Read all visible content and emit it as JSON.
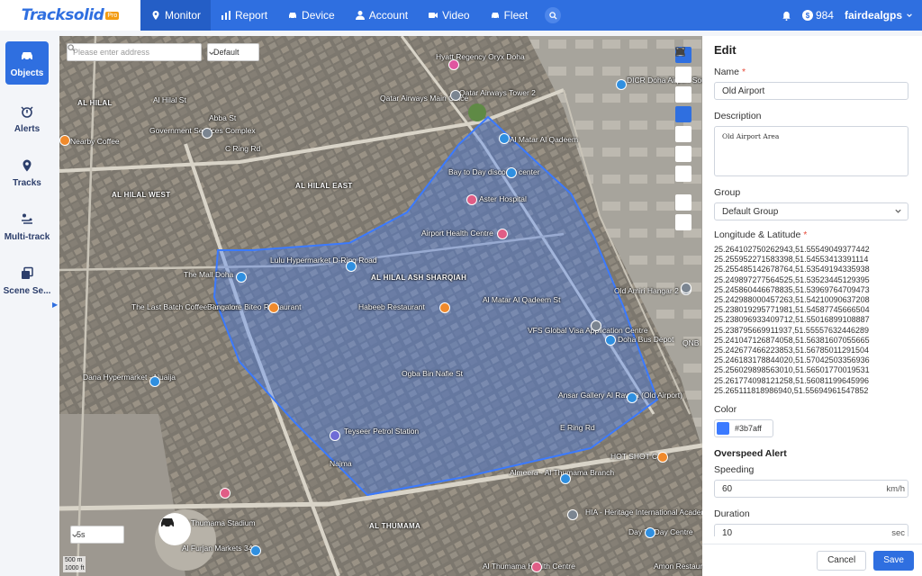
{
  "brand": {
    "name": "Tracksolid",
    "badge": "Pro"
  },
  "nav": [
    {
      "label": "Monitor",
      "icon": "location-pin-icon",
      "active": true
    },
    {
      "label": "Report",
      "icon": "bar-chart-icon"
    },
    {
      "label": "Device",
      "icon": "car-icon"
    },
    {
      "label": "Account",
      "icon": "user-icon"
    },
    {
      "label": "Video",
      "icon": "video-camera-icon"
    },
    {
      "label": "Fleet",
      "icon": "car-icon"
    }
  ],
  "header": {
    "balance": "984",
    "username": "fairdealgps"
  },
  "sidebar": [
    {
      "label": "Objects",
      "icon": "car-icon",
      "active": true
    },
    {
      "label": "Alerts",
      "icon": "alert-icon"
    },
    {
      "label": "Tracks",
      "icon": "location-pin-icon"
    },
    {
      "label": "Multi-track",
      "icon": "multi-track-icon"
    },
    {
      "label": "Scene Se...",
      "icon": "scene-icon"
    }
  ],
  "map": {
    "search_placeholder": "Please enter address",
    "map_type": "Default",
    "interval": "5s",
    "scale_m": "500 m",
    "scale_ft": "1000 ft",
    "geofence_color": "#3b7aff",
    "labels": [
      {
        "text": "Hyatt Regency Oryx Doha",
        "bold": false
      },
      {
        "text": "Qatar Airways Tower 2",
        "bold": false
      },
      {
        "text": "DICR Doha Airport South",
        "bold": false
      },
      {
        "text": "Qatar Airways Main Office",
        "bold": false
      },
      {
        "text": "AL HILAL",
        "bold": true
      },
      {
        "text": "Abba St",
        "bold": false
      },
      {
        "text": "Al Hilal St",
        "bold": false
      },
      {
        "text": "Government Services Complex",
        "bold": false
      },
      {
        "text": "C Ring Rd",
        "bold": false
      },
      {
        "text": "Nearby Coffee",
        "bold": false
      },
      {
        "text": "Al Matar Al Qadeem",
        "bold": false
      },
      {
        "text": "Bay to Day discount center",
        "bold": false
      },
      {
        "text": "AL HILAL WEST",
        "bold": true
      },
      {
        "text": "AL HILAL EAST",
        "bold": true
      },
      {
        "text": "Aster Hospital",
        "bold": false
      },
      {
        "text": "Airport Health Centre",
        "bold": false
      },
      {
        "text": "Lulu Hypermarket D-Ring Road",
        "bold": false
      },
      {
        "text": "The Mall Doha",
        "bold": false
      },
      {
        "text": "AL HILAL ASH SHARQIAH",
        "bold": true
      },
      {
        "text": "Al Matar Al Qadeem St",
        "bold": false
      },
      {
        "text": "The Last Batch Coffee Roasters",
        "bold": false
      },
      {
        "text": "Bangalore Biteo Restaurant",
        "bold": false
      },
      {
        "text": "Habeeb Restaurant",
        "bold": false
      },
      {
        "text": "VFS Global Visa Application Centre",
        "bold": false
      },
      {
        "text": "Old Amiri Hangar 2",
        "bold": false
      },
      {
        "text": "Doha Bus Depot",
        "bold": false
      },
      {
        "text": "QNB",
        "bold": false
      },
      {
        "text": "Dana Hypermarket - Nuaija",
        "bold": false
      },
      {
        "text": "Ogba Bin Nafie St",
        "bold": false
      },
      {
        "text": "Ansar Gallery Al Rawda (Old Airport)",
        "bold": false
      },
      {
        "text": "Teyseer Petrol Station",
        "bold": false
      },
      {
        "text": "E Ring Rd",
        "bold": false
      },
      {
        "text": "HOT SHOT Cafe",
        "bold": false
      },
      {
        "text": "Najma",
        "bold": false
      },
      {
        "text": "Almeera - Al Thumama Branch",
        "bold": false
      },
      {
        "text": "AL THUMAMA",
        "bold": true
      },
      {
        "text": "HIA - Heritage International Academy",
        "bold": false
      },
      {
        "text": "Day To Day Centre",
        "bold": false
      },
      {
        "text": "Al Thumama Stadium",
        "bold": false
      },
      {
        "text": "Al Furjan Markets 34",
        "bold": false
      },
      {
        "text": "Al Thumama Health Centre",
        "bold": false
      },
      {
        "text": "Amon Restaurant",
        "bold": false
      }
    ]
  },
  "panel": {
    "title": "Edit",
    "name_label": "Name",
    "name_value": "Old Airport",
    "description_label": "Description",
    "description_value": "Old Airport Area",
    "group_label": "Group",
    "group_value": "Default Group",
    "coords_label": "Longitude & Latitude",
    "coords": [
      "25.264102750262943,51.55549049377442",
      "25.255952271583398,51.54553413391114",
      "25.255485142678764,51.53549194335938",
      "25.249897277564525,51.53523445129395",
      "25.245860446678835,51.53969764709473",
      "25.242988000457263,51.54210090637208",
      "25.238019295771981,51.54587745666504",
      "25.238096933409712,51.55016899108887",
      "25.238795669911937,51.55557632446289",
      "25.241047126874058,51.56381607055665",
      "25.242677466223853,51.56785011291504",
      "25.246183178844020,51.57042503356936",
      "25.256029898563010,51.56501770019531",
      "25.261774098121258,51.56081199645996",
      "25.265111818986940,51.55694961547852"
    ],
    "color_label": "Color",
    "color_value": "#3b7aff",
    "overspeed_label": "Overspeed Alert",
    "speed_label": "Speeding",
    "speed_value": "60",
    "speed_unit": "km/h",
    "duration_label": "Duration",
    "duration_value": "10",
    "duration_unit": "sec",
    "cancel_label": "Cancel",
    "save_label": "Save"
  }
}
